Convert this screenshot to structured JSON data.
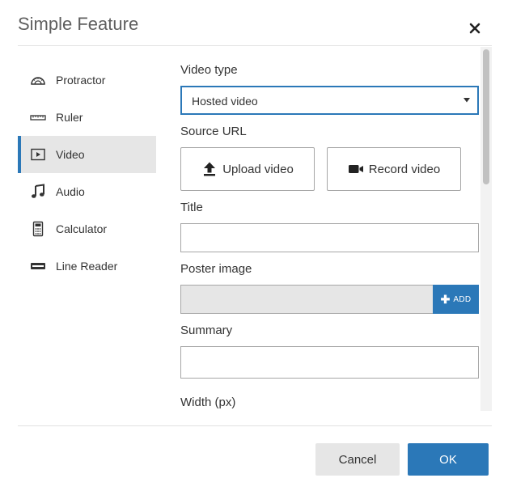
{
  "dialog": {
    "title": "Simple Feature",
    "close_icon": "close-icon"
  },
  "nav": {
    "items": [
      {
        "label": "Protractor",
        "icon": "protractor-icon",
        "active": false
      },
      {
        "label": "Ruler",
        "icon": "ruler-icon",
        "active": false
      },
      {
        "label": "Video",
        "icon": "video-icon",
        "active": true
      },
      {
        "label": "Audio",
        "icon": "music-note-icon",
        "active": false
      },
      {
        "label": "Calculator",
        "icon": "calculator-icon",
        "active": false
      },
      {
        "label": "Line Reader",
        "icon": "line-reader-icon",
        "active": false
      }
    ]
  },
  "form": {
    "video_type": {
      "label": "Video type",
      "value": "Hosted video"
    },
    "source_url": {
      "label": "Source URL"
    },
    "upload_button": {
      "label": "Upload video",
      "icon": "upload-icon"
    },
    "record_button": {
      "label": "Record video",
      "icon": "video-camera-icon"
    },
    "title": {
      "label": "Title",
      "value": ""
    },
    "poster_image": {
      "label": "Poster image",
      "value": "",
      "add_label": "ADD",
      "add_icon": "plus-icon"
    },
    "summary": {
      "label": "Summary",
      "value": ""
    },
    "width": {
      "label": "Width (px)"
    }
  },
  "footer": {
    "cancel_label": "Cancel",
    "ok_label": "OK"
  },
  "colors": {
    "accent": "#2b78b8",
    "active_nav_bg": "#e6e6e6",
    "field_border": "#a6a6a6"
  }
}
